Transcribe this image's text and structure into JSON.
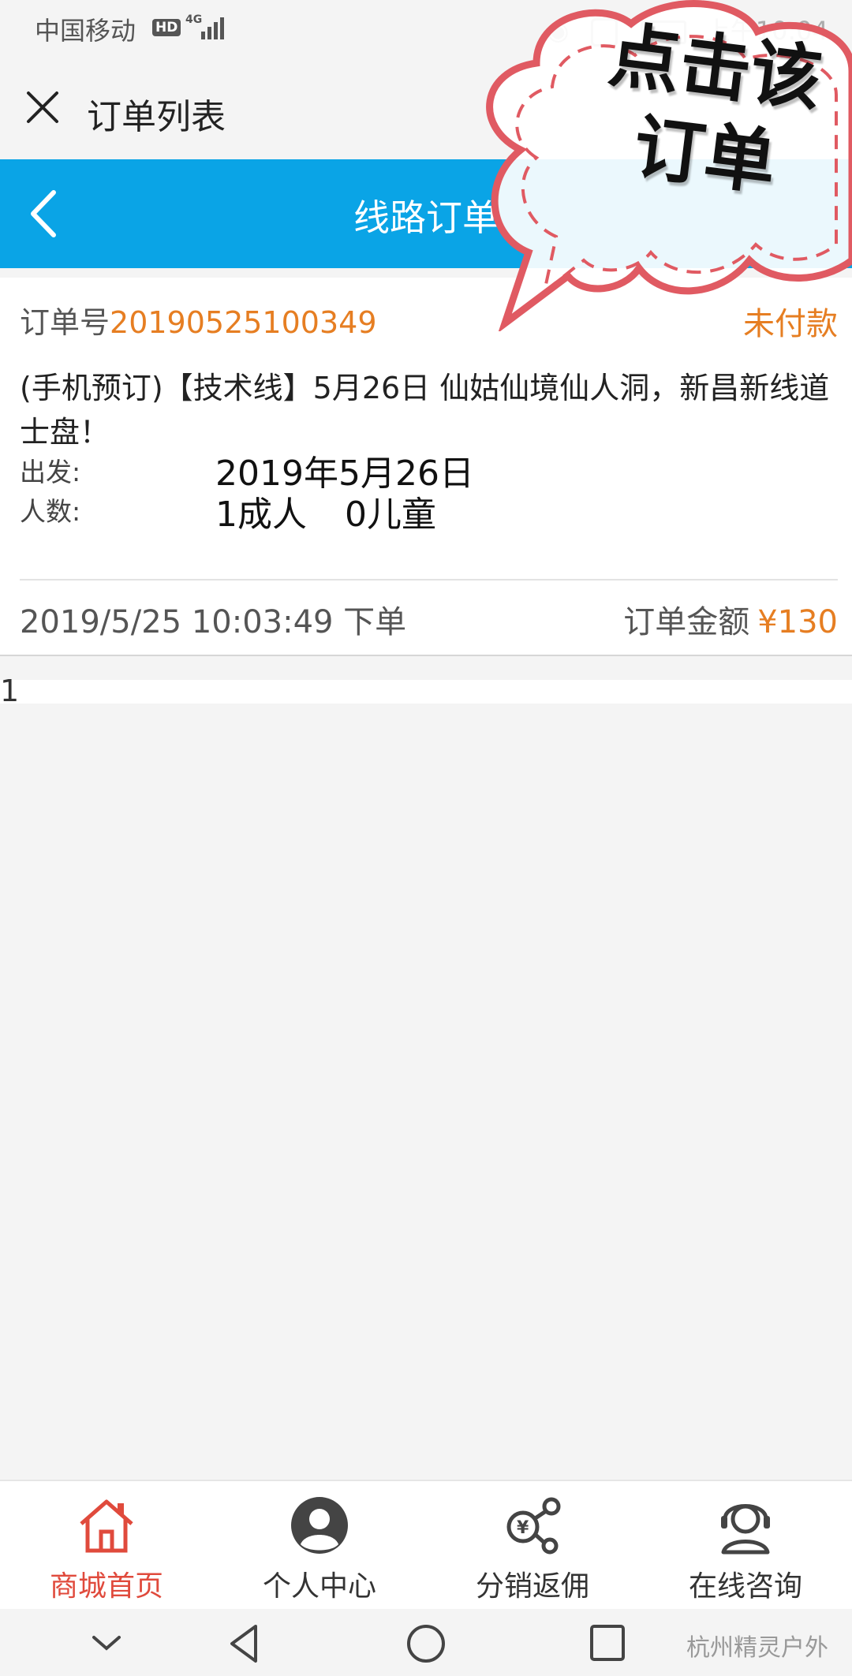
{
  "status_bar": {
    "carrier": "中国移动",
    "hd_badge": "HD",
    "network": "4G",
    "time": "上午10:04"
  },
  "title_bar": {
    "title": "订单列表"
  },
  "header": {
    "title": "线路订单"
  },
  "callout": {
    "line1": "点击该",
    "line2": "订单"
  },
  "order": {
    "order_no_label": "订单号",
    "order_no": "20190525100349",
    "status": "未付款",
    "product_title": "(手机预订)【技术线】5月26日 仙姑仙境仙人洞，新昌新线道士盘！",
    "depart_label": "出发:",
    "depart_date": "2019年5月26日",
    "people_label": "人数:",
    "adults": "1成人",
    "children": "0儿童",
    "placed_time": "2019/5/25 10:03:49 下单",
    "amount_label": "订单金额",
    "amount": "¥130"
  },
  "page_indicator": "1",
  "bottom_nav": [
    {
      "label": "商城首页",
      "icon": "home-icon",
      "active": true
    },
    {
      "label": "个人中心",
      "icon": "user-icon",
      "active": false
    },
    {
      "label": "分销返佣",
      "icon": "commission-icon",
      "active": false
    },
    {
      "label": "在线咨询",
      "icon": "headset-icon",
      "active": false
    }
  ],
  "watermark": "杭州精灵户外",
  "colors": {
    "header_blue": "#0aa4e6",
    "accent_orange": "#e67e22",
    "active_red": "#e04a3c",
    "callout_border": "#e05a62"
  }
}
